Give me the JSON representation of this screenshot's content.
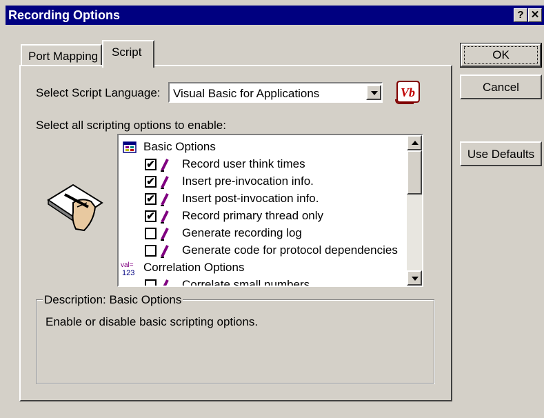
{
  "window": {
    "title": "Recording Options",
    "help_label": "?",
    "close_label": "✕"
  },
  "tabs": [
    {
      "label": "Port Mapping"
    },
    {
      "label": "Script"
    }
  ],
  "script_tab": {
    "language_label": "Select Script Language:",
    "language_value": "Visual Basic for Applications",
    "options_label": "Select all scripting options to enable:",
    "tree": [
      {
        "type": "group",
        "label": "Basic Options",
        "icon": "basic-options-icon"
      },
      {
        "type": "option",
        "label": "Record user think times",
        "checked": true
      },
      {
        "type": "option",
        "label": "Insert pre-invocation info.",
        "checked": true
      },
      {
        "type": "option",
        "label": "Insert post-invocation info.",
        "checked": true
      },
      {
        "type": "option",
        "label": "Record primary thread only",
        "checked": true
      },
      {
        "type": "option",
        "label": "Generate recording log",
        "checked": false
      },
      {
        "type": "option",
        "label": "Generate code for protocol dependencies",
        "checked": false
      },
      {
        "type": "group",
        "label": "Correlation Options",
        "icon": "val-123-icon"
      },
      {
        "type": "option",
        "label": "Correlate small numbers",
        "checked": false
      }
    ],
    "description_title": "Description: Basic Options",
    "description_text": "Enable or disable basic scripting options."
  },
  "buttons": {
    "ok": "OK",
    "cancel": "Cancel",
    "use_defaults": "Use Defaults"
  },
  "colors": {
    "titlebar": "#000080",
    "face": "#d4d0c8",
    "pencil": "#800080"
  }
}
